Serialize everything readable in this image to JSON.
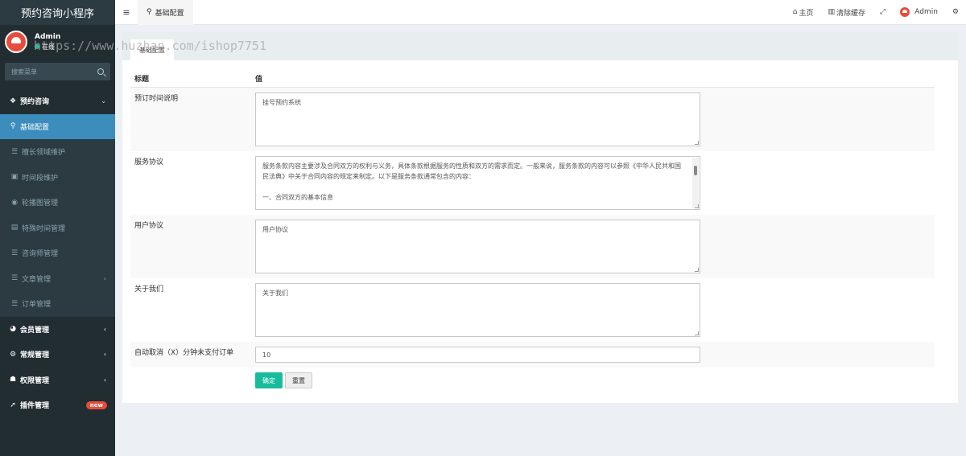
{
  "app": {
    "brand": "预约咨询小程序"
  },
  "user": {
    "name": "Admin",
    "status": "在线"
  },
  "watermark": "https://www.huzhan.com/ishop7751",
  "sidebar": {
    "search_placeholder": "搜索菜单",
    "items": [
      {
        "label": "预约咨询",
        "icon": "cubes-icon",
        "glyph": "❖",
        "type": "top",
        "arrow": "⌄"
      },
      {
        "label": "基础配置",
        "icon": "map-marker-icon",
        "glyph": "⚲",
        "type": "active"
      },
      {
        "label": "擅长领域维护",
        "icon": "list-icon",
        "glyph": "☰",
        "type": "sub"
      },
      {
        "label": "时间段维护",
        "icon": "image-icon",
        "glyph": "▣",
        "type": "sub"
      },
      {
        "label": "轮播图管理",
        "icon": "circle-icon",
        "glyph": "◉",
        "type": "sub"
      },
      {
        "label": "特殊时间管理",
        "icon": "file-icon",
        "glyph": "▤",
        "type": "sub"
      },
      {
        "label": "咨询师管理",
        "icon": "list-icon",
        "glyph": "☰",
        "type": "sub"
      },
      {
        "label": "文章管理",
        "icon": "list-icon",
        "glyph": "☰",
        "type": "sub",
        "arrow": "‹"
      },
      {
        "label": "订单管理",
        "icon": "list-icon",
        "glyph": "☰",
        "type": "sub"
      },
      {
        "label": "会员管理",
        "icon": "user-circle-icon",
        "glyph": "◕",
        "type": "top",
        "arrow": "‹"
      },
      {
        "label": "常规管理",
        "icon": "cogs-icon",
        "glyph": "⚙",
        "type": "top",
        "arrow": "‹"
      },
      {
        "label": "权限管理",
        "icon": "group-icon",
        "glyph": "☗",
        "type": "top",
        "arrow": "‹"
      },
      {
        "label": "插件管理",
        "icon": "rocket-icon",
        "glyph": "➚",
        "type": "top",
        "badge": "new"
      }
    ]
  },
  "header": {
    "menu_glyph": "≡",
    "tab_label": "基础配置",
    "tab_glyph": "⚲",
    "home_label": "主页",
    "home_glyph": "⌂",
    "clear_cache_label": "清除缓存",
    "clear_cache_glyph": "▥",
    "fullscreen_glyph": "⤢",
    "admin_label": "Admin",
    "settings_glyph": "⚙"
  },
  "panel": {
    "tab_label": "基础配置",
    "table_header": {
      "title": "标题",
      "value": "值"
    },
    "rows": [
      {
        "title": "预订时间说明",
        "value": "挂号预约系统"
      },
      {
        "title": "服务协议",
        "value": "服务条款内容主要涉及合同双方的权利与义务，具体条款根据服务的性质和双方的需求而定。一般来说，服务条款的内容可以参照《中华人民共和国民法典》中关于合同内容的规定来制定。以下是服务条款通常包含的内容：\n\n一、合同双方的基本信息\n\n此项内容包括各自的身份信息，明确合同双方的身份和联系方式，以便在合同履行过程中进行沟通和协调。"
      },
      {
        "title": "用户协议",
        "value": "用户协议"
      },
      {
        "title": "关于我们",
        "value": "关于我们"
      },
      {
        "title": "自动取消（X）分钟未支付订单",
        "value": "10"
      }
    ],
    "confirm_label": "确定",
    "reset_label": "重置"
  }
}
